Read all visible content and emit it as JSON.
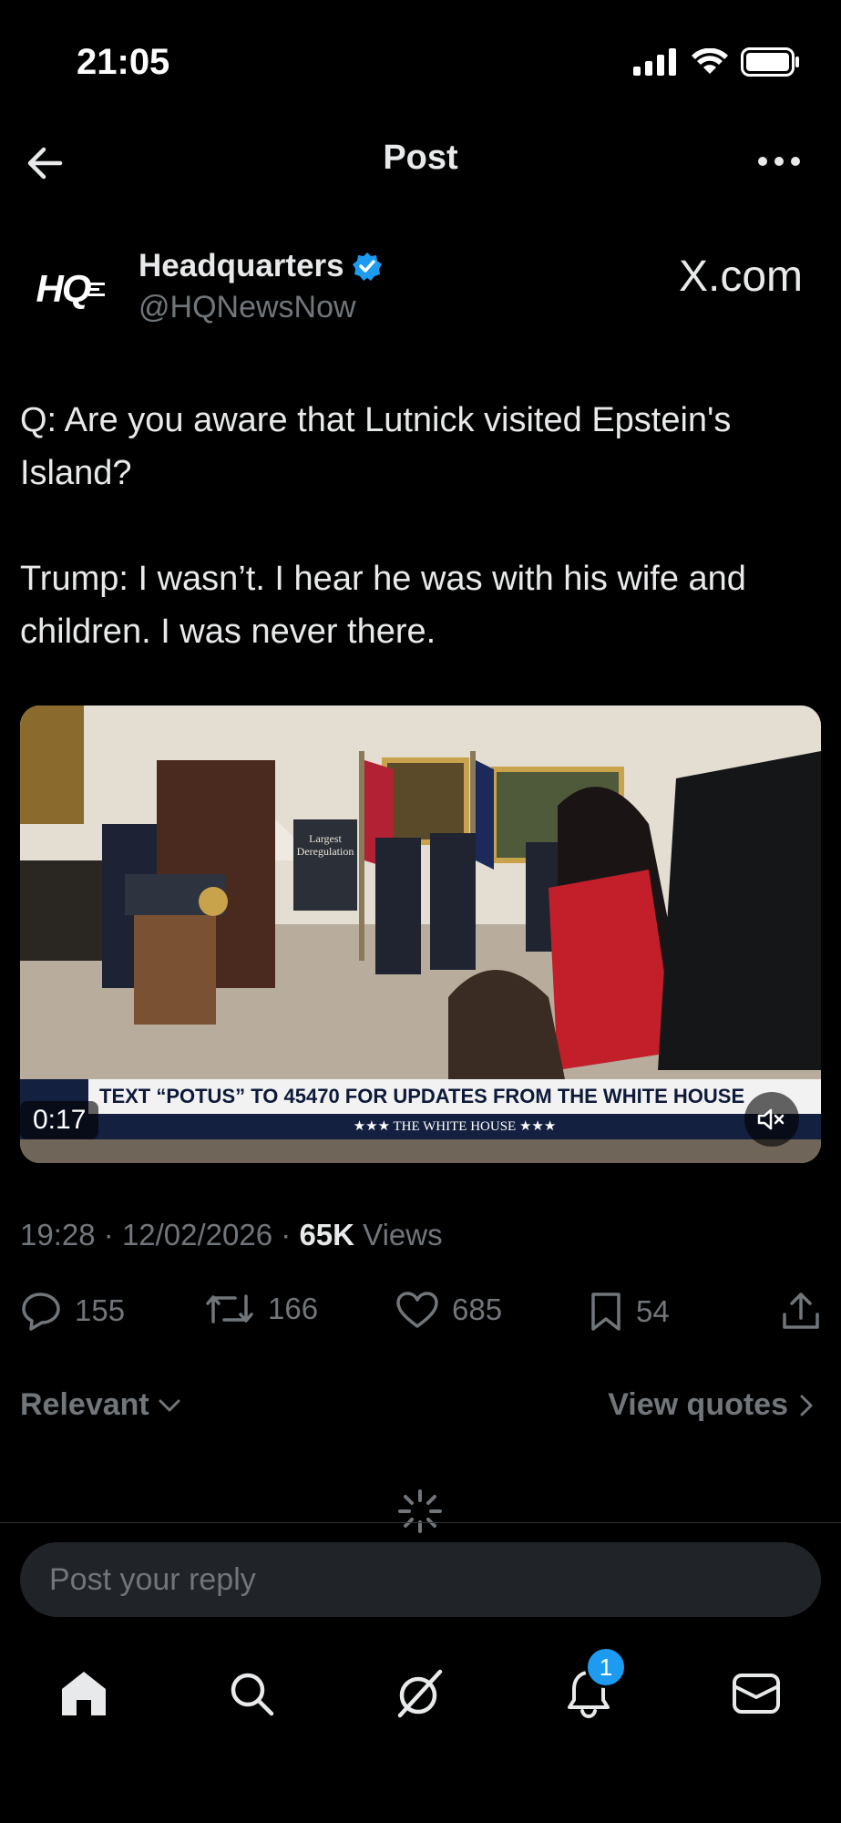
{
  "status_bar": {
    "time": "21:05"
  },
  "header": {
    "title": "Post"
  },
  "author": {
    "name": "Headquarters",
    "handle": "@HQNewsNow",
    "avatar_text": "HQ",
    "source_label": "X.com"
  },
  "tweet": {
    "text": "Q: Are you aware that Lutnick visited Epstein's Island?\n\nTrump: I wasn’t. I hear he was with his wife and children. I was never there."
  },
  "media": {
    "duration": "0:17",
    "easel_text": "Largest Deregulation",
    "banner_main": "TEXT “POTUS” TO 45470 FOR UPDATES FROM THE WHITE HOUSE",
    "banner_sub": "★★★  THE WHITE HOUSE  ★★★"
  },
  "meta": {
    "time": "19:28",
    "date": "12/02/2026",
    "views_count": "65K",
    "views_label": "Views"
  },
  "actions": {
    "replies": "155",
    "reposts": "166",
    "likes": "685",
    "bookmarks": "54"
  },
  "replies_bar": {
    "sort": "Relevant",
    "view_quotes": "View quotes"
  },
  "reply": {
    "placeholder": "Post your reply"
  },
  "tabbar": {
    "notification_count": "1"
  },
  "colors": {
    "accent": "#1d9bf0",
    "background": "#000000",
    "muted": "#71767b"
  }
}
